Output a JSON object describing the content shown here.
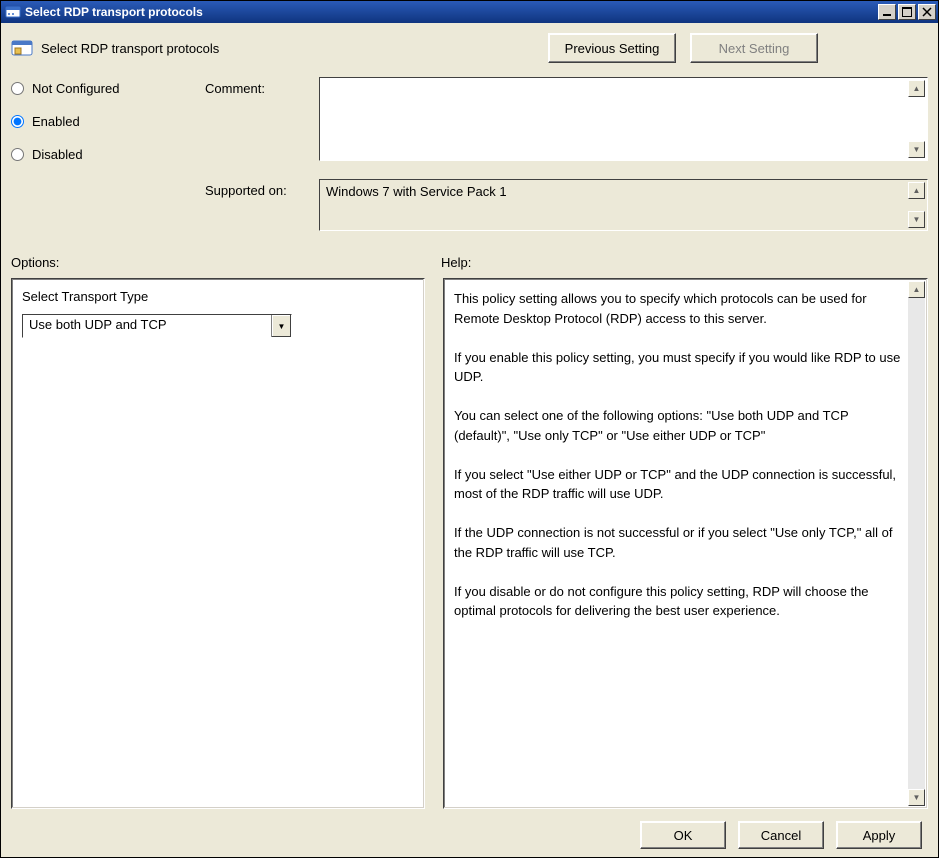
{
  "window": {
    "title": "Select RDP transport protocols"
  },
  "header": {
    "policy_name": "Select RDP transport protocols",
    "prev_label": "Previous Setting",
    "next_label": "Next Setting"
  },
  "state": {
    "not_configured_label": "Not Configured",
    "enabled_label": "Enabled",
    "disabled_label": "Disabled",
    "selected": "enabled"
  },
  "comment": {
    "label": "Comment:",
    "value": ""
  },
  "supported": {
    "label": "Supported on:",
    "value": "Windows 7 with Service Pack 1"
  },
  "sections": {
    "options_label": "Options:",
    "help_label": "Help:"
  },
  "options": {
    "transport_type_label": "Select Transport Type",
    "transport_type_value": "Use both UDP and TCP"
  },
  "help_text": "This policy setting allows you to specify which protocols can be used for Remote Desktop Protocol (RDP) access to this server.\n\nIf you enable this policy setting, you must specify if you would like RDP to use UDP.\n\nYou can select one of the following options: \"Use both UDP and TCP (default)\", \"Use only TCP\" or \"Use either UDP or TCP\"\n\nIf you select \"Use either UDP or TCP\" and the UDP connection is successful, most of the RDP traffic will use UDP.\n\nIf the UDP connection is not successful or if you select \"Use only TCP,\" all of the RDP traffic will use TCP.\n\nIf you disable or do not configure this policy setting, RDP will choose the optimal protocols for delivering the best user experience.",
  "footer": {
    "ok_label": "OK",
    "cancel_label": "Cancel",
    "apply_label": "Apply"
  }
}
